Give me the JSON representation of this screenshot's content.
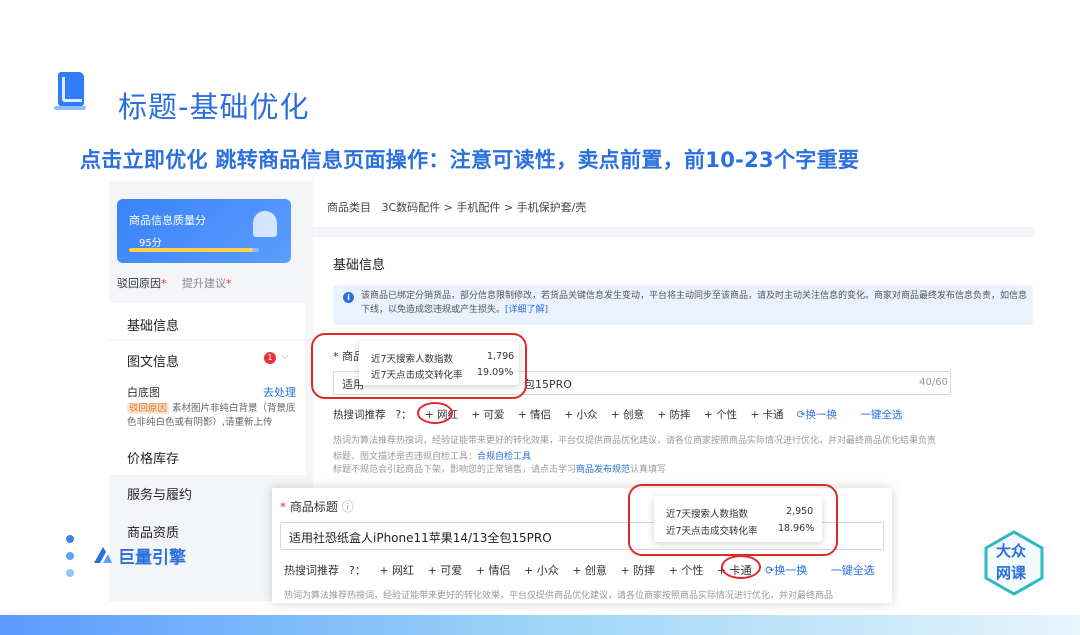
{
  "slide": {
    "title": "标题-基础优化",
    "subtitle": "点击立即优化 跳转商品信息页面操作：注意可读性，卖点前置，前10-23个字重要",
    "brand_left": "巨量引擎",
    "brand_right_line1": "大众",
    "brand_right_line2": "网课"
  },
  "sidebar": {
    "quality_label": "商品信息质量分",
    "quality_score_text": "95分",
    "quality_score_fraction": 0.95,
    "reject_reason": "驳回原因",
    "improve_suggestion": "提升建议",
    "nav_basic": "基础信息",
    "nav_graphic": "图文信息",
    "graphic_badge": "1",
    "white_bg_label": "白底图",
    "todo_link": "去处理",
    "reject_tag": "驳回原因",
    "reject_note": "素材图片非纯白背景（背景底色非纯白色或有阴影）,请重新上传",
    "nav_price": "价格库存",
    "nav_service": "服务与履约",
    "nav_qualification": "商品资质"
  },
  "main": {
    "breadcrumb_label": "商品类目",
    "breadcrumb_path": "3C数码配件 > 手机配件 > 手机保护套/壳",
    "section_title": "基础信息",
    "notice_text_1": "该商品已绑定分销货品，部分信息限制修改，若货品关键信息发生变动，平台将主动同步至该商品，请及时主动关注信息的变化。商家对商品最终发布信息负责，如信息",
    "notice_text_2": "下线，以免造成您违规或产生损失。",
    "notice_link": "[详细了解]",
    "field_label_a": "* 商品",
    "title_value_a": "适用",
    "title_value_a_tail": "包15PRO",
    "char_count_a": "40/60",
    "hot_label": "热搜词推荐",
    "tags": [
      "+ 网红",
      "+ 可爱",
      "+ 情侣",
      "+ 小众",
      "+ 创意",
      "+ 防摔",
      "+ 个性",
      "+ 卡通"
    ],
    "swap": "换一换",
    "select_all": "一键全选",
    "hint_1": "热词为算法推荐热搜词，经验证能带来更好的转化效果，平台仅提供商品优化建议，请各位商家按照商品实际情况进行优化，并对最终商品优化结果负责",
    "hint_2_prefix": "标题、图文描述是否违规自检工具：",
    "hint_2_link": "合规自检工具",
    "hint_3_prefix": "标题不规范会引起商品下架，影响您的正常销售，请点击学习",
    "hint_3_link": "商品发布规范",
    "hint_3_suffix": "认真填写"
  },
  "popup_a": {
    "row1_label": "近7天搜索人数指数",
    "row1_value": "1,796",
    "row2_label": "近7天点击成交转化率",
    "row2_value": "19.09%"
  },
  "overlay": {
    "label": "商品标题",
    "title_value": "适用社恐纸盒人iPhone11苹果14/13全包15PRO",
    "hot_label": "热搜词推荐",
    "tags": [
      "+ 网红",
      "+ 可爱",
      "+ 情侣",
      "+ 小众",
      "+ 创意",
      "+ 防摔",
      "+ 个性",
      "+ 卡通"
    ],
    "swap": "换一换",
    "select_all": "一键全选",
    "hint": "热词为算法推荐热搜词，经验证能带来更好的转化效果，平台仅提供商品优化建议，请各位商家按照商品实际情况进行优化，并对最终商品"
  },
  "popup_b": {
    "row1_label": "近7天搜索人数指数",
    "row1_value": "2,950",
    "row2_label": "近7天点击成交转化率",
    "row2_value": "18.96%"
  }
}
